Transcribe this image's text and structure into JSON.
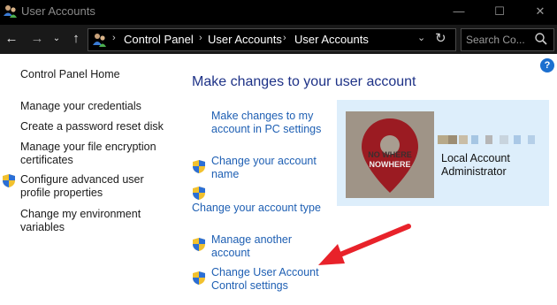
{
  "window": {
    "title": "User Accounts",
    "controls": {
      "minimize": "—",
      "maximize": "☐",
      "close": "✕"
    }
  },
  "nav": {
    "back": "←",
    "forward": "→",
    "recent": "⌄",
    "up": "↑"
  },
  "breadcrumb": [
    "Control Panel",
    "User Accounts",
    "User Accounts"
  ],
  "search": {
    "placeholder": "Search Co..."
  },
  "help": {
    "label": "?"
  },
  "sidebar": {
    "items": [
      {
        "label": "Control Panel Home",
        "shield": false
      },
      {
        "label": "Manage your credentials",
        "shield": false
      },
      {
        "label": "Create a password reset disk",
        "shield": false
      },
      {
        "label": "Manage your file encryption certificates",
        "shield": false
      },
      {
        "label": "Configure advanced user profile properties",
        "shield": true
      },
      {
        "label": "Change my environment variables",
        "shield": false
      }
    ]
  },
  "main": {
    "heading": "Make changes to your user account",
    "links": [
      {
        "label": "Make changes to my account in PC settings",
        "shield": false
      },
      {
        "label": "Change your account name",
        "shield": true
      },
      {
        "label": "Change your account type",
        "shield": true
      },
      {
        "label": "Manage another account",
        "shield": true
      },
      {
        "label": "Change User Account Control settings",
        "shield": true
      }
    ]
  },
  "account": {
    "avatar_text": "NO WHERE NOWHERE",
    "name": "Local Account",
    "type": "Administrator"
  },
  "colors": {
    "titlebar": "#000000",
    "addressbar": "#191919",
    "heading": "#1e3287",
    "link": "#1e5fb3",
    "card": "#ddeefb",
    "arrow": "#e8222a"
  }
}
